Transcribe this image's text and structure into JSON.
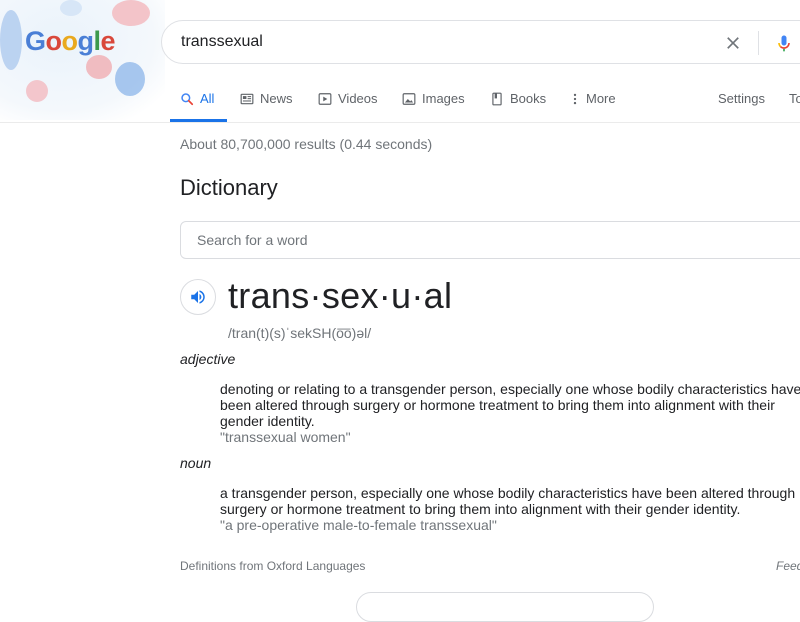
{
  "logo": {
    "text_letters": [
      "G",
      "o",
      "o",
      "g",
      "l",
      "e"
    ]
  },
  "search": {
    "query": "transsexual"
  },
  "tabs": [
    {
      "label": "All",
      "icon": "search-icon"
    },
    {
      "label": "News",
      "icon": "news-icon"
    },
    {
      "label": "Videos",
      "icon": "video-icon"
    },
    {
      "label": "Images",
      "icon": "image-icon"
    },
    {
      "label": "Books",
      "icon": "book-icon"
    },
    {
      "label": "More",
      "icon": "more-vert-icon"
    }
  ],
  "tabs_right": {
    "settings": "Settings",
    "tools": "To"
  },
  "result_stats": "About 80,700,000 results (0.44 seconds)",
  "dictionary": {
    "title": "Dictionary",
    "search_placeholder": "Search for a word",
    "headword": "trans·sex·u·al",
    "phonetic": "/tran(t)(s)ˈsekSH(o͞o)əl/",
    "entries": [
      {
        "pos": "adjective",
        "definition": "denoting or relating to a transgender person, especially one whose bodily characteristics have been altered through surgery or hormone treatment to bring them into alignment with their gender identity.",
        "example": "\"transsexual women\""
      },
      {
        "pos": "noun",
        "definition": "a transgender person, especially one whose bodily characteristics have been altered through surgery or hormone treatment to bring them into alignment with their gender identity.",
        "example": "\"a pre-operative male-to-female transsexual\""
      }
    ],
    "source": "Definitions from Oxford Languages",
    "feedback": "Feedback"
  },
  "colors": {
    "accent": "#1a73e8",
    "muted": "#70757a",
    "text": "#202124"
  }
}
